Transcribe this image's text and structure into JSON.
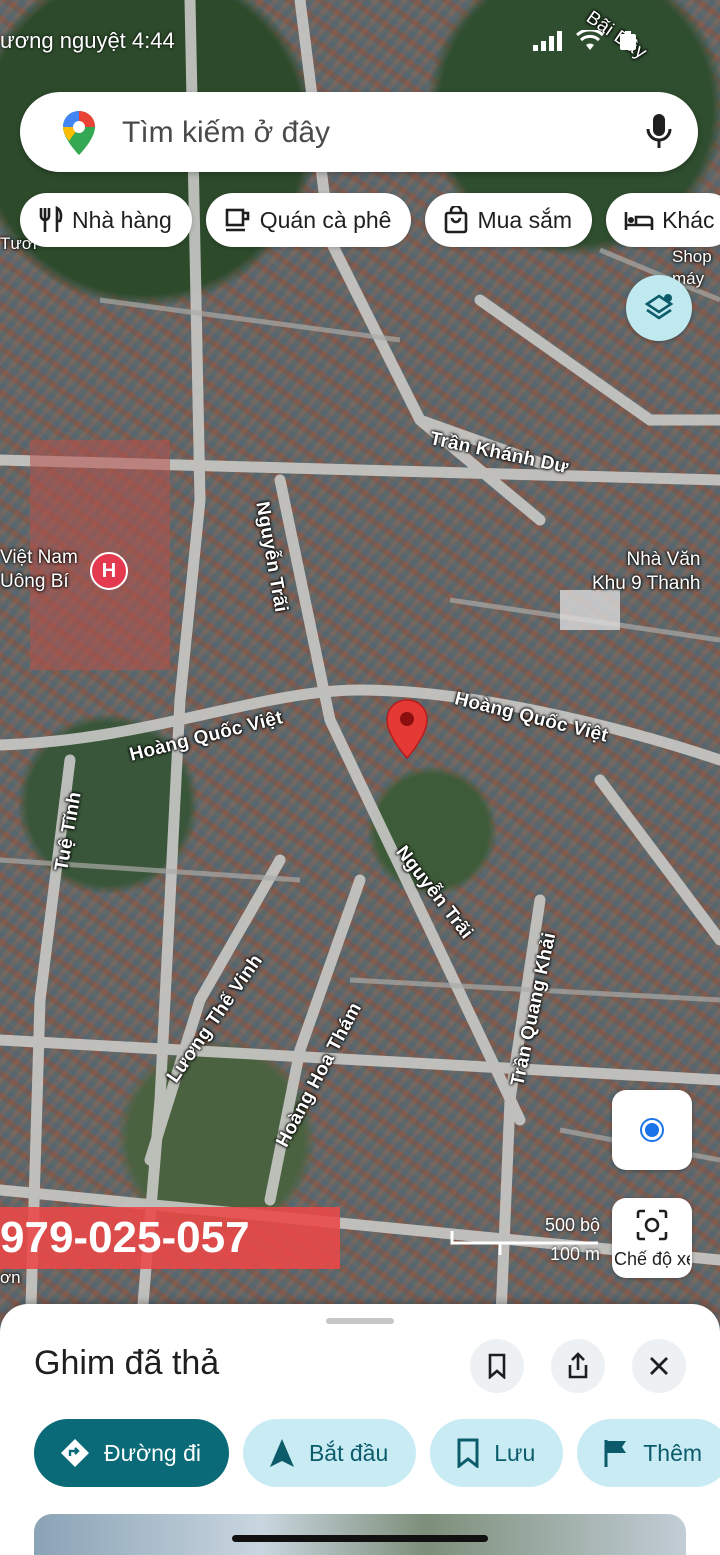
{
  "status_bar": {
    "left_text": "ương nguyệt 4:44",
    "icons": [
      "location-arrow-icon",
      "signal-icon",
      "wifi-icon",
      "battery-icon"
    ]
  },
  "search": {
    "placeholder": "Tìm kiếm ở đây",
    "icons": [
      "maps-pin-logo",
      "mic-icon"
    ]
  },
  "chips": [
    {
      "label": "Nhà hàng",
      "icon": "fork-knife-icon"
    },
    {
      "label": "Quán cà phê",
      "icon": "coffee-cup-icon"
    },
    {
      "label": "Mua sắm",
      "icon": "shopping-bag-icon"
    },
    {
      "label": "Khác",
      "icon": "bed-icon"
    }
  ],
  "map": {
    "road_labels": {
      "tran_khanh_du": "Trần Khánh Dư",
      "nguyen_trai_north": "Nguyễn Trãi",
      "hoang_quoc_viet_west": "Hoàng Quốc Việt",
      "hoang_quoc_viet_east": "Hoàng Quốc Việt",
      "tue_tinh": "Tuệ Tĩnh",
      "nguyen_trai_south": "Nguyễn Trãi",
      "tran_quang_khai": "Trần Quang Khải",
      "luong_the_vinh": "Lương Thế Vinh",
      "hoang_hoa_tham": "Hoàng Hoa Thám",
      "bai_duong": "Bãi Dây"
    },
    "place_labels": {
      "viet_nam_uong_bi": "Việt Nam\nUông Bí",
      "nha_van_hoa": "Nhà Văn\nKhu 9 Thanh",
      "shop_may": "Shop\nmáy",
      "tuoi": "Tươi",
      "son": "ơn"
    },
    "hospital_marker": "H",
    "scale": {
      "top": "500 bộ",
      "bottom": "100 m"
    },
    "lens_label": "Chế độ xem"
  },
  "watermark_phone": "979-025-057",
  "sheet": {
    "title": "Ghim đã thả",
    "actions": [
      {
        "label": "Đường đi",
        "icon": "directions-icon"
      },
      {
        "label": "Bắt đầu",
        "icon": "navigation-arrow-icon"
      },
      {
        "label": "Lưu",
        "icon": "bookmark-icon"
      },
      {
        "label": "Thêm",
        "icon": "flag-icon"
      }
    ]
  },
  "colors": {
    "primary_action": "#0b6a78",
    "secondary_action": "#c9ecf4",
    "pin_red": "#e53935",
    "location_blue": "#1a73e8"
  }
}
